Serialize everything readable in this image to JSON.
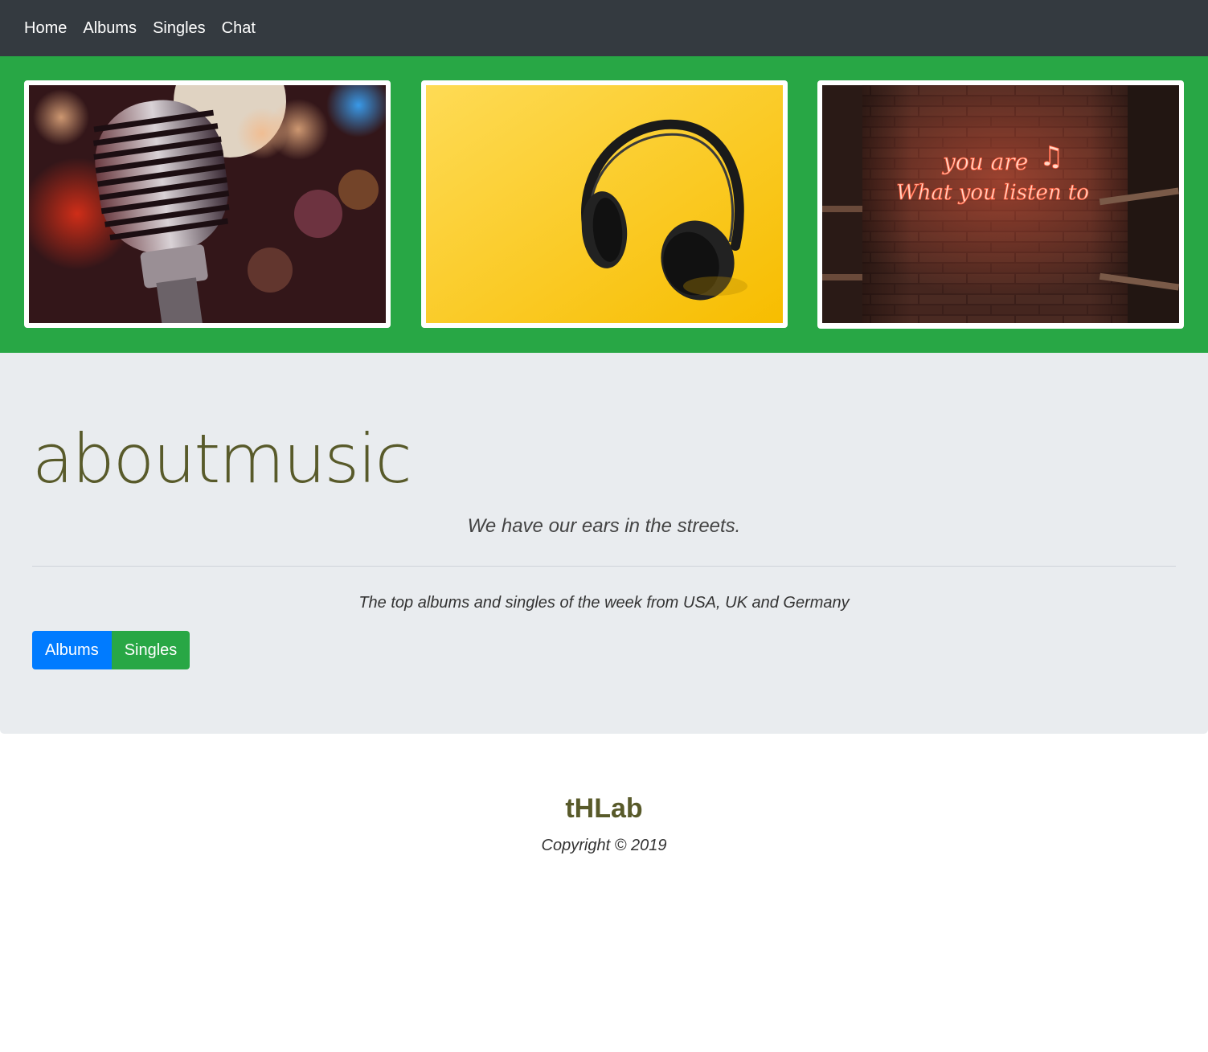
{
  "nav": {
    "items": [
      {
        "label": "Home"
      },
      {
        "label": "Albums"
      },
      {
        "label": "Singles"
      },
      {
        "label": "Chat"
      }
    ]
  },
  "gallery": {
    "images": [
      {
        "icon": "microphone-photo"
      },
      {
        "icon": "headphones-photo"
      },
      {
        "icon": "neon-sign-photo",
        "text_line1": "you are",
        "text_line2": "What you listen to"
      }
    ]
  },
  "hero": {
    "title": "aboutmusic",
    "tagline": "We have our ears in the streets.",
    "lead": "The top albums and singles of the week from USA, UK and Germany",
    "buttons": {
      "albums": "Albums",
      "singles": "Singles"
    }
  },
  "footer": {
    "brand": "tHLab",
    "copyright": "Copyright © 2019"
  },
  "colors": {
    "navbar": "#343a40",
    "gallery_bg": "#28a745",
    "jumbotron_bg": "#e9ecef",
    "title": "#585a2a",
    "primary": "#007bff",
    "success": "#28a745"
  }
}
